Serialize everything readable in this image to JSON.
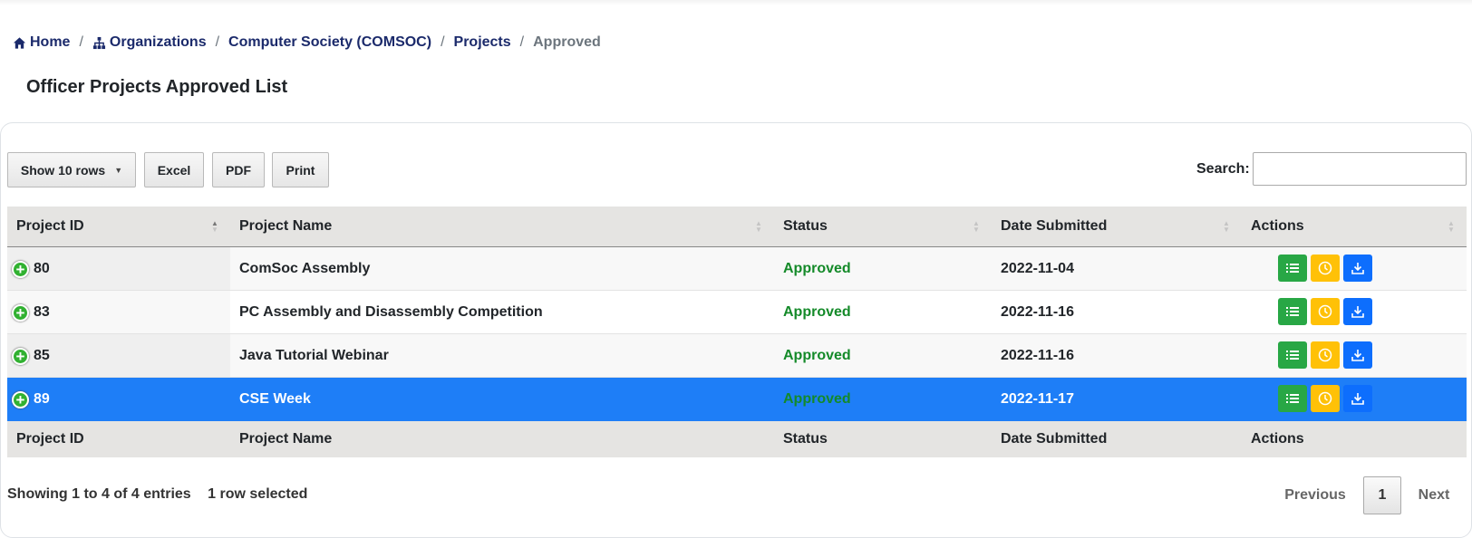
{
  "breadcrumb": {
    "home": "Home",
    "organizations": "Organizations",
    "org": "Computer Society (COMSOC)",
    "projects": "Projects",
    "current": "Approved"
  },
  "page_title": "Officer Projects Approved List",
  "toolbar": {
    "rows_label": "Show 10 rows",
    "excel": "Excel",
    "pdf": "PDF",
    "print": "Print"
  },
  "search": {
    "label": "Search:",
    "value": ""
  },
  "table": {
    "headers": [
      "Project ID",
      "Project Name",
      "Status",
      "Date Submitted",
      "Actions"
    ],
    "rows": [
      {
        "id": "80",
        "name": "ComSoc Assembly",
        "status": "Approved",
        "date": "2022-11-04"
      },
      {
        "id": "83",
        "name": "PC Assembly and Disassembly Competition",
        "status": "Approved",
        "date": "2022-11-16"
      },
      {
        "id": "85",
        "name": "Java Tutorial Webinar",
        "status": "Approved",
        "date": "2022-11-16"
      },
      {
        "id": "89",
        "name": "CSE Week",
        "status": "Approved",
        "date": "2022-11-17"
      }
    ],
    "selected_row": 3
  },
  "info": {
    "showing": "Showing 1 to 4 of 4 entries",
    "selected": "1 row selected"
  },
  "pagination": {
    "previous": "Previous",
    "current": "1",
    "next": "Next"
  },
  "colors": {
    "accent_link": "#1b2a6b",
    "selected_row": "#1e7ef7",
    "status_approved": "#148a29",
    "btn_view": "#28a745",
    "btn_history": "#ffc107",
    "btn_download": "#0d6efd"
  },
  "icons": {
    "home": "home-icon",
    "organizations": "sitemap-icon",
    "view": "list-icon",
    "history": "clock-icon",
    "download": "download-icon",
    "expand": "plus-circle-icon"
  }
}
